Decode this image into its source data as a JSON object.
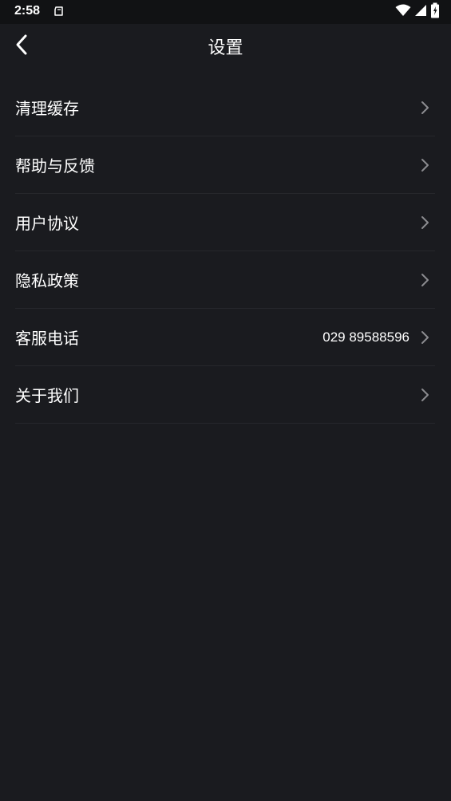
{
  "status_bar": {
    "time": "2:58",
    "icons": [
      "notification-icon",
      "wifi-icon",
      "signal-icon",
      "battery-icon"
    ]
  },
  "header": {
    "title": "设置"
  },
  "settings": {
    "items": [
      {
        "label": "清理缓存",
        "value": ""
      },
      {
        "label": "帮助与反馈",
        "value": ""
      },
      {
        "label": "用户协议",
        "value": ""
      },
      {
        "label": "隐私政策",
        "value": ""
      },
      {
        "label": "客服电话",
        "value": "029 89588596"
      },
      {
        "label": "关于我们",
        "value": ""
      }
    ]
  },
  "colors": {
    "background": "#1a1b1f",
    "status_bar": "#111214",
    "divider": "#26272c",
    "text": "#ffffff",
    "chevron": "#8c8c90"
  }
}
